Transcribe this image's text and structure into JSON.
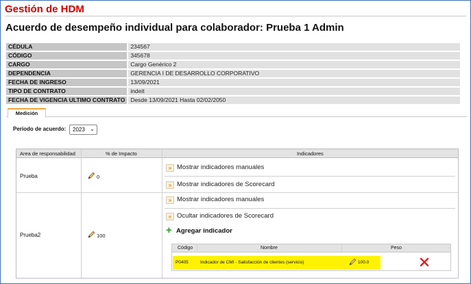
{
  "app": {
    "title": "Gestión de HDM"
  },
  "page": {
    "title": "Acuerdo de desempeño individual para colaborador: Prueba 1 Admin"
  },
  "employee": [
    {
      "label": "CÉDULA",
      "value": "234567"
    },
    {
      "label": "CÓDIGO",
      "value": "345678"
    },
    {
      "label": "CARGO",
      "value": "Cargo Genérico 2"
    },
    {
      "label": "DEPENDENCIA",
      "value": "GERENCIA I DE DESARROLLO CORPORATIVO"
    },
    {
      "label": "FECHA DE INGRESO",
      "value": "13/09/2021"
    },
    {
      "label": "TIPO DE CONTRATO",
      "value": "indeit"
    },
    {
      "label": "FECHA DE VIGENCIA ULTIMO CONTRATO",
      "value": "Desde 13/09/2021 Hasta 02/02/2050"
    }
  ],
  "tabs": [
    {
      "label": "Medición",
      "active": true
    }
  ],
  "period": {
    "label": "Período de acuerdo:",
    "value": "2023"
  },
  "grid": {
    "headers": {
      "area": "Area de responsabilidad",
      "impact": "% de Impacto",
      "indicators": "Indicadores"
    },
    "rows": [
      {
        "area": "Prueba",
        "impact": "0",
        "actions": [
          "Mostrar indicadores manuales",
          "Mostrar indicadores de Scorecard"
        ]
      },
      {
        "area": "Prueba2",
        "impact": "100",
        "actions": [
          "Mostrar indicadores manuales",
          "Ocultar indicadores de Scorecard"
        ],
        "add_label": "Agregar indicador",
        "subtable": {
          "headers": {
            "code": "Código",
            "name": "Nombre",
            "weight": "Peso"
          },
          "rows": [
            {
              "code": "P0405",
              "name": "Indicador de CMI - Satisfacción de clientes (servicio)",
              "weight": "100.0"
            }
          ]
        }
      }
    ]
  },
  "colors": {
    "title_red": "#cc0000",
    "highlight": "#fff200",
    "tab_accent": "#f3a43a",
    "add_green": "#2e9b2e"
  },
  "icons": [
    "pencil-icon",
    "expand-arrow-icon",
    "collapse-arrow-icon",
    "plus-icon",
    "delete-x-icon",
    "chevron-down-icon"
  ]
}
